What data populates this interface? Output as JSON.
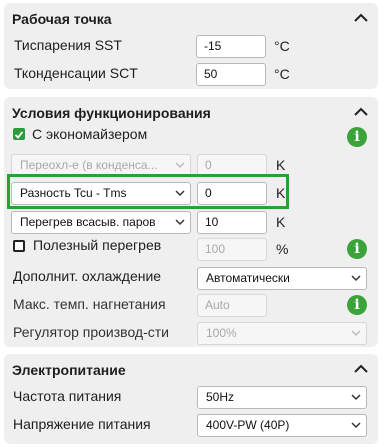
{
  "operating_point": {
    "title": "Рабочая точка",
    "evap_label": "Тиспарения SST",
    "evap_value": "-15",
    "evap_unit": "°C",
    "cond_label": "Тконденсации SCT",
    "cond_value": "50",
    "cond_unit": "°C"
  },
  "conditions": {
    "title": "Условия функционирования",
    "economizer_label": "С экономайзером",
    "economizer_checked": true,
    "subcool_select": "Переохл-е (в конденса...",
    "subcool_value": "0",
    "subcool_unit": "K",
    "diff_select": "Разность Tcu - Tms",
    "diff_value": "0",
    "diff_unit": "K",
    "superheat_select": "Перегрев всасыв. паров",
    "superheat_value": "10",
    "superheat_unit": "K",
    "useful_superheat_label": "Полезный перегрев",
    "useful_superheat_checked": false,
    "useful_superheat_value": "100",
    "useful_superheat_unit": "%",
    "extra_cooling_label": "Дополнит. охлаждение",
    "extra_cooling_value": "Автоматически",
    "max_discharge_label": "Макс. темп. нагнетания",
    "max_discharge_value": "Auto",
    "capacity_reg_label": "Регулятор производ-сти",
    "capacity_reg_value": "100%"
  },
  "power": {
    "title": "Электропитание",
    "freq_label": "Частота питания",
    "freq_value": "50Hz",
    "voltage_label": "Напряжение питания",
    "voltage_value": "400V-PW (40P)"
  },
  "icons": {
    "info": "i"
  },
  "colors": {
    "panel_bg": "#efefef",
    "accent_green": "#3aa33a",
    "highlight_green": "#27a32f"
  }
}
